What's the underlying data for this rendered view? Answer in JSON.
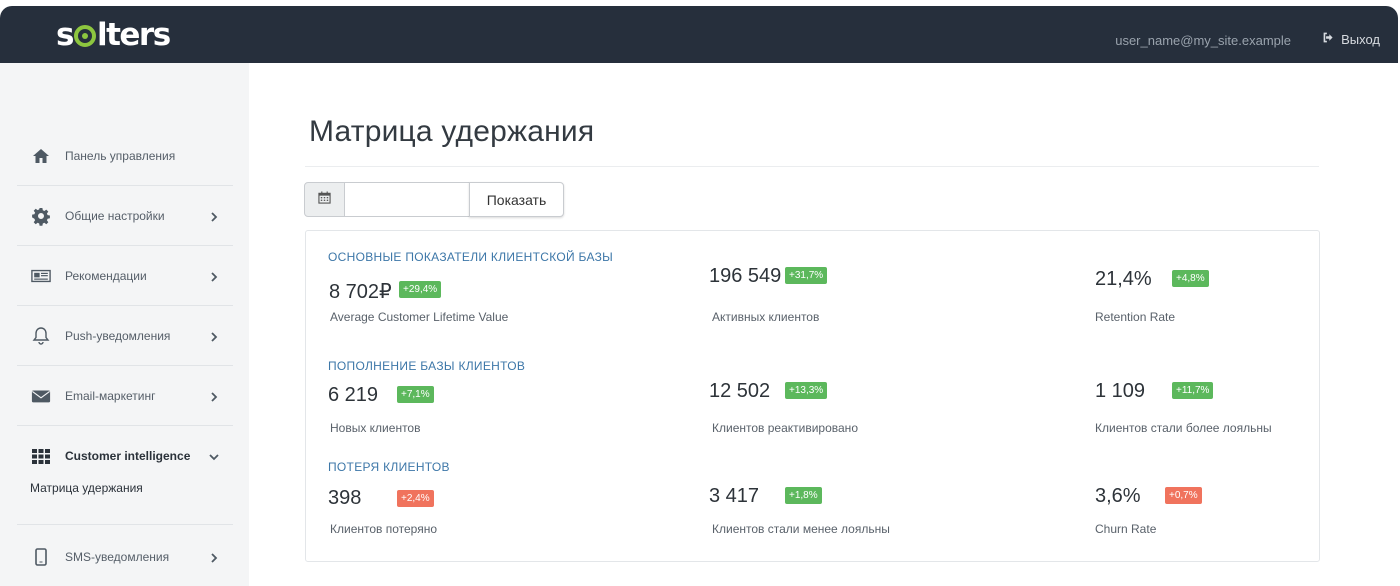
{
  "header": {
    "logo_text_left": "s",
    "logo_text_right": "lters",
    "user_email": "user_name@my_site.example",
    "logout_label": "Выход",
    "colors": {
      "background": "#262f3c",
      "logo_accent": "#8dc63f"
    }
  },
  "sidebar": {
    "items": [
      {
        "label": "Панель управления",
        "icon": "home-icon",
        "has_chevron": false
      },
      {
        "label": "Общие настройки",
        "icon": "gear-icon",
        "has_chevron": true
      },
      {
        "label": "Рекомендации",
        "icon": "newspaper-icon",
        "has_chevron": true
      },
      {
        "label": "Push-уведомления",
        "icon": "bell-icon",
        "has_chevron": true
      },
      {
        "label": "Email-маркетинг",
        "icon": "envelope-icon",
        "has_chevron": true
      },
      {
        "label": "Customer intelligence",
        "icon": "grid-icon",
        "has_chevron": true,
        "expanded": true
      },
      {
        "label": "SMS-уведомления",
        "icon": "mobile-icon",
        "has_chevron": true
      }
    ],
    "sub_item": "Матрица удержания"
  },
  "page": {
    "title": "Матрица удержания",
    "date_input_value": "",
    "show_button": "Показать"
  },
  "sections": [
    {
      "title": "ОСНОВНЫЕ ПОКАЗАТЕЛИ КЛИЕНТСКОЙ БАЗЫ",
      "metrics": [
        {
          "value": "8 702₽",
          "change": "+29,4%",
          "trend": "up",
          "label": "Average Customer Lifetime Value"
        },
        {
          "value": "196 549",
          "change": "+31,7%",
          "trend": "up",
          "label": "Активных клиентов"
        },
        {
          "value": "21,4%",
          "change": "+4,8%",
          "trend": "up",
          "label": "Retention Rate"
        }
      ]
    },
    {
      "title": "ПОПОЛНЕНИЕ БАЗЫ КЛИЕНТОВ",
      "metrics": [
        {
          "value": "6 219",
          "change": "+7,1%",
          "trend": "up",
          "label": "Новых клиентов"
        },
        {
          "value": "12 502",
          "change": "+13,3%",
          "trend": "up",
          "label": "Клиентов реактивировано"
        },
        {
          "value": "1 109",
          "change": "+11,7%",
          "trend": "up",
          "label": "Клиентов стали более лояльны"
        }
      ]
    },
    {
      "title": "ПОТЕРЯ КЛИЕНТОВ",
      "metrics": [
        {
          "value": "398",
          "change": "+2,4%",
          "trend": "down",
          "label": "Клиентов потеряно"
        },
        {
          "value": "3 417",
          "change": "+1,8%",
          "trend": "up",
          "label": "Клиентов стали менее лояльны"
        },
        {
          "value": "3,6%",
          "change": "+0,7%",
          "trend": "down",
          "label": "Churn Rate"
        }
      ]
    }
  ],
  "colors": {
    "badge_up": "#5cb85c",
    "badge_down": "#f0735d",
    "section_title": "#3d77a8"
  }
}
